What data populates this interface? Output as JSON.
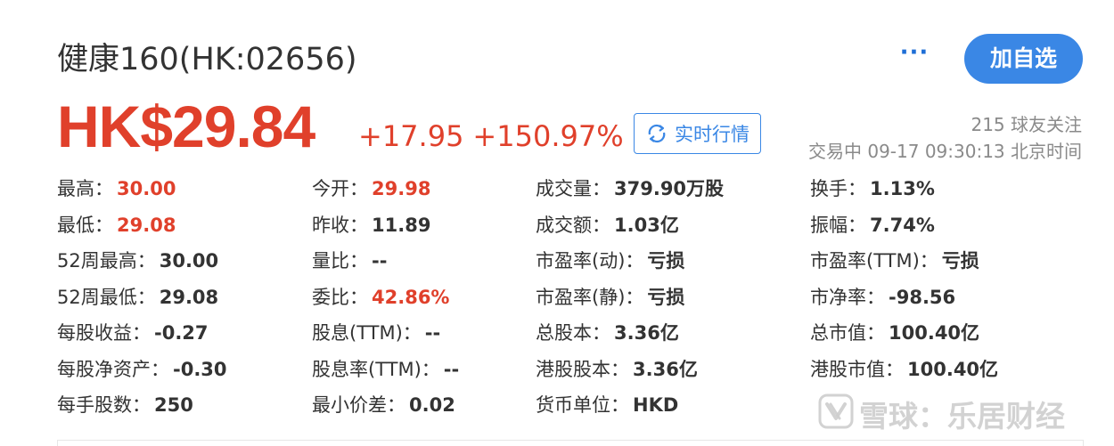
{
  "header": {
    "title": "健康160(HK:02656)",
    "more_label": "···",
    "watch_label": "加自选"
  },
  "quote": {
    "price": "HK$29.84",
    "change": "+17.95",
    "change_pct": "+150.97%",
    "realtime_label": "实时行情",
    "followers": "215 球友关注",
    "status": "交易中 09-17 09:30:13 北京时间"
  },
  "stats": [
    [
      {
        "k": "最高：",
        "v": "30.00",
        "red": true
      },
      {
        "k": "最低：",
        "v": "29.08",
        "red": true
      },
      {
        "k": "52周最高：",
        "v": "30.00",
        "red": false
      },
      {
        "k": "52周最低：",
        "v": "29.08",
        "red": false
      },
      {
        "k": "每股收益：",
        "v": "-0.27",
        "red": false
      },
      {
        "k": "每股净资产：",
        "v": "-0.30",
        "red": false
      },
      {
        "k": "每手股数：",
        "v": "250",
        "red": false
      }
    ],
    [
      {
        "k": "今开：",
        "v": "29.98",
        "red": true
      },
      {
        "k": "昨收：",
        "v": "11.89",
        "red": false
      },
      {
        "k": "量比：",
        "v": "--",
        "red": false
      },
      {
        "k": "委比：",
        "v": "42.86%",
        "red": true
      },
      {
        "k": "股息(TTM)：",
        "v": "--",
        "red": false
      },
      {
        "k": "股息率(TTM)：",
        "v": "--",
        "red": false
      },
      {
        "k": "最小价差：",
        "v": "0.02",
        "red": false
      }
    ],
    [
      {
        "k": "成交量：",
        "v": "379.90万股",
        "red": false
      },
      {
        "k": "成交额：",
        "v": "1.03亿",
        "red": false
      },
      {
        "k": "市盈率(动)：",
        "v": "亏损",
        "red": false
      },
      {
        "k": "市盈率(静)：",
        "v": "亏损",
        "red": false
      },
      {
        "k": "总股本：",
        "v": "3.36亿",
        "red": false
      },
      {
        "k": "港股股本：",
        "v": "3.36亿",
        "red": false
      },
      {
        "k": "货币单位：",
        "v": "HKD",
        "red": false
      }
    ],
    [
      {
        "k": "换手：",
        "v": "1.13%",
        "red": false
      },
      {
        "k": "振幅：",
        "v": "7.74%",
        "red": false
      },
      {
        "k": "市盈率(TTM)：",
        "v": "亏损",
        "red": false
      },
      {
        "k": "市净率：",
        "v": "-98.56",
        "red": false
      },
      {
        "k": "总市值：",
        "v": "100.40亿",
        "red": false
      },
      {
        "k": "港股市值：",
        "v": "100.40亿",
        "red": false
      }
    ]
  ],
  "watermark": "雪球：乐居财经",
  "colors": {
    "up": "#e0402b",
    "accent": "#3a87e5",
    "muted": "#8a8a8a",
    "text": "#333333"
  },
  "icons": {
    "more": "more-dots-icon",
    "realtime": "refresh-icon",
    "watermark": "snowball-logo-icon"
  }
}
